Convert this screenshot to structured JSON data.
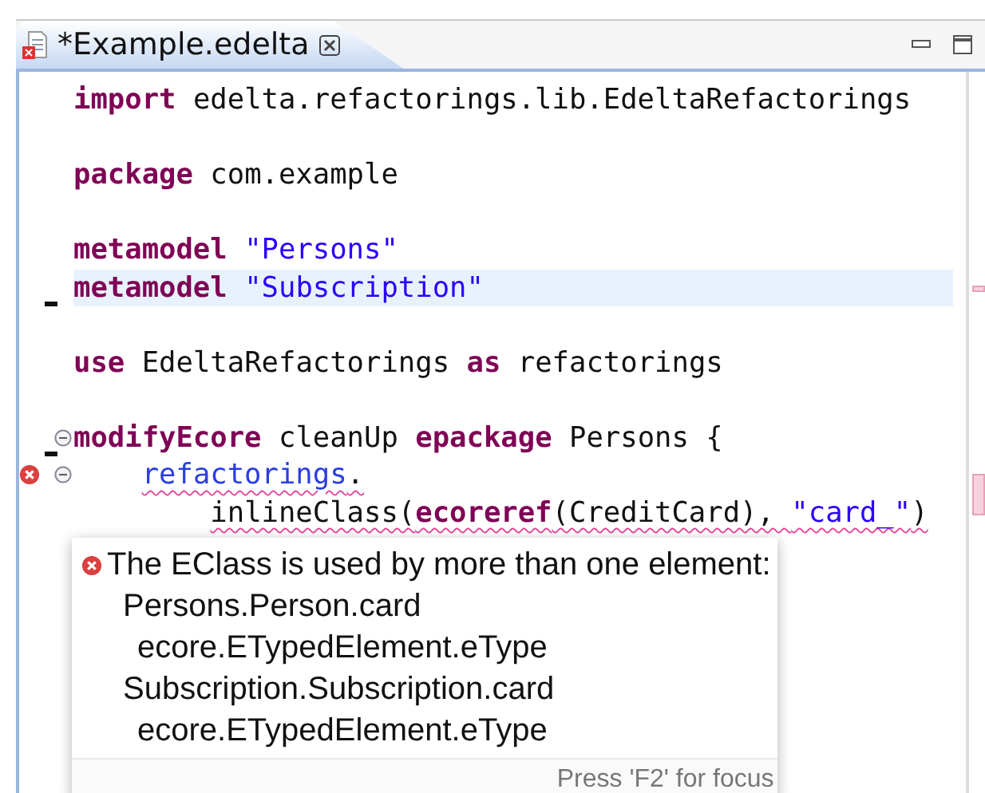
{
  "tab": {
    "title": "*Example.edelta",
    "selected": true
  },
  "editor": {
    "lines": [
      {
        "kind": "code",
        "tokens": [
          {
            "kind": "keyword",
            "text": "import"
          },
          {
            "kind": "plain",
            "text": " edelta.refactorings.lib.EdeltaRefactorings"
          }
        ]
      },
      {
        "kind": "blank"
      },
      {
        "kind": "code",
        "tokens": [
          {
            "kind": "keyword",
            "text": "package"
          },
          {
            "kind": "plain",
            "text": " com.example"
          }
        ]
      },
      {
        "kind": "blank"
      },
      {
        "kind": "code",
        "tokens": [
          {
            "kind": "keyword",
            "text": "metamodel"
          },
          {
            "kind": "string",
            "text": " \"Persons\""
          }
        ]
      },
      {
        "kind": "code",
        "highlighted": true,
        "change_marker": true,
        "tokens": [
          {
            "kind": "keyword",
            "text": "metamodel"
          },
          {
            "kind": "string",
            "text": " \"Subscription\""
          }
        ]
      },
      {
        "kind": "blank"
      },
      {
        "kind": "code",
        "tokens": [
          {
            "kind": "keyword",
            "text": "use"
          },
          {
            "kind": "plain",
            "text": " EdeltaRefactorings "
          },
          {
            "kind": "keyword",
            "text": "as"
          },
          {
            "kind": "plain",
            "text": " refactorings"
          }
        ]
      },
      {
        "kind": "blank"
      },
      {
        "kind": "code",
        "change_marker": true,
        "fold": true,
        "tokens": [
          {
            "kind": "keyword",
            "text": "modifyEcore"
          },
          {
            "kind": "plain",
            "text": " cleanUp "
          },
          {
            "kind": "keyword",
            "text": "epackage"
          },
          {
            "kind": "plain",
            "text": " Persons {"
          }
        ]
      },
      {
        "kind": "code",
        "fold": true,
        "error": true,
        "tokens": [
          {
            "kind": "reference",
            "text": "    refactorings",
            "squiggle": true
          },
          {
            "kind": "plain",
            "text": ".",
            "squiggle": true
          }
        ]
      },
      {
        "kind": "code",
        "tokens": [
          {
            "kind": "plain",
            "text": "        inlineClass(",
            "squiggle": true
          },
          {
            "kind": "keyword",
            "text": "ecoreref",
            "squiggle": true
          },
          {
            "kind": "plain",
            "text": "(CreditCard), ",
            "squiggle": true
          },
          {
            "kind": "string",
            "text": "\"card_\"",
            "squiggle": true
          },
          {
            "kind": "plain",
            "text": ")",
            "squiggle": true
          }
        ]
      }
    ]
  },
  "tooltip": {
    "message": "The EClass is used by more than one element:",
    "details": [
      {
        "text": "Persons.Person.card",
        "children": [
          {
            "text": "ecore.ETypedElement.eType"
          }
        ]
      },
      {
        "text": "Subscription.Subscription.card",
        "children": [
          {
            "text": "ecore.ETypedElement.eType"
          }
        ]
      }
    ],
    "footer": "Press 'F2' for focus"
  }
}
